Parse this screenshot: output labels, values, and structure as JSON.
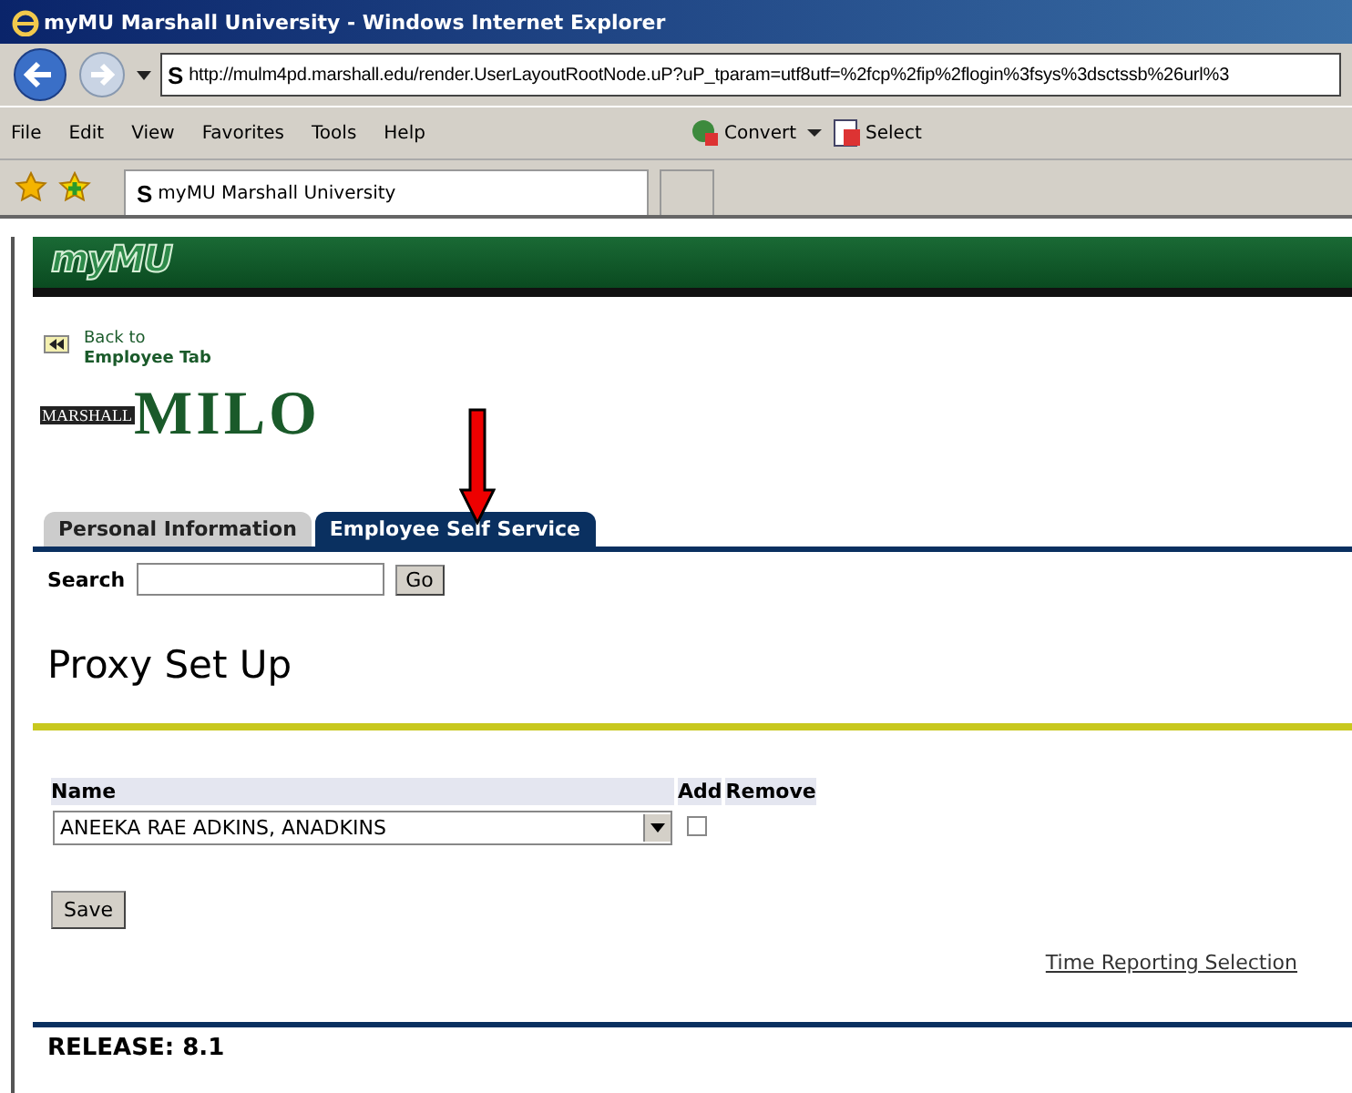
{
  "window": {
    "title": "myMU Marshall University - Windows Internet Explorer"
  },
  "address": {
    "icon": "S",
    "value": "http://mulm4pd.marshall.edu/render.UserLayoutRootNode.uP?uP_tparam=utf8utf=%2fcp%2fip%2flogin%3fsys%3dsctssb%26url%3"
  },
  "menu": [
    "File",
    "Edit",
    "View",
    "Favorites",
    "Tools",
    "Help"
  ],
  "toolbar": [
    "Convert",
    "Select"
  ],
  "browser_tab": {
    "icon": "S",
    "title": "myMU Marshall University"
  },
  "banner": {
    "logo": "myMU"
  },
  "back_link": [
    "Back to",
    "Employee Tab"
  ],
  "milo_logo": {
    "small": "MARSHALL",
    "big": "MILO"
  },
  "tabs": [
    {
      "label": "Personal Information",
      "selected": false
    },
    {
      "label": "Employee Self Service",
      "selected": true
    }
  ],
  "search": {
    "label": "Search",
    "button": "Go"
  },
  "page_title": "Proxy Set Up",
  "table": {
    "columns": [
      "Name",
      "Add",
      "Remove"
    ],
    "rows": [
      {
        "name": "ANEEKA RAE ADKINS, ANADKINS",
        "add": false
      }
    ]
  },
  "save_button": "Save",
  "link": "Time Reporting Selection",
  "release": "RELEASE: 8.1"
}
